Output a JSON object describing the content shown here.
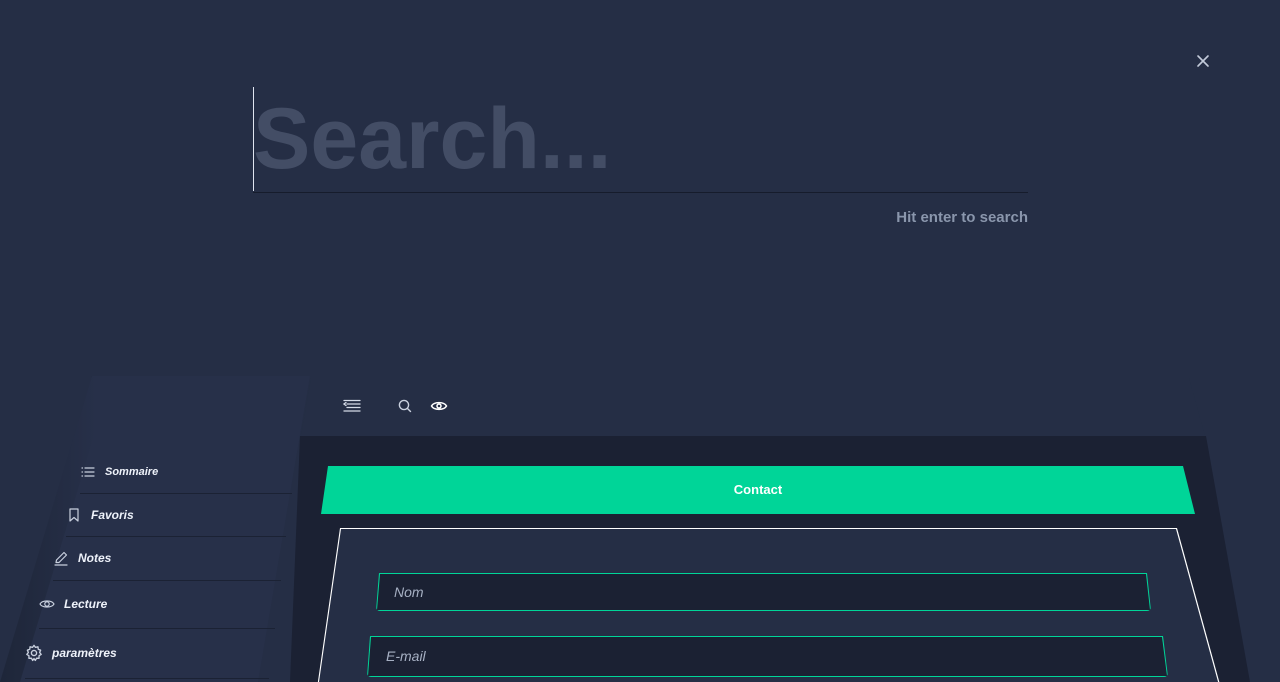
{
  "search": {
    "placeholder": "Search...",
    "hint": "Hit enter to search"
  },
  "sidebar": {
    "items": [
      {
        "label": "Sommaire",
        "icon": "list-icon"
      },
      {
        "label": "Favoris",
        "icon": "bookmark-icon"
      },
      {
        "label": "Notes",
        "icon": "pencil-icon"
      },
      {
        "label": "Lecture",
        "icon": "eye-icon"
      },
      {
        "label": "paramètres",
        "icon": "gear-icon"
      }
    ]
  },
  "toolbar": {
    "icons": [
      "menu-icon",
      "search-icon",
      "eye-icon"
    ]
  },
  "contact": {
    "title": "Contact",
    "fields": [
      {
        "placeholder": "Nom"
      },
      {
        "placeholder": "E-mail"
      }
    ]
  },
  "colors": {
    "background": "#252e45",
    "accent": "#00d598",
    "panel_dark": "#1b2133"
  }
}
